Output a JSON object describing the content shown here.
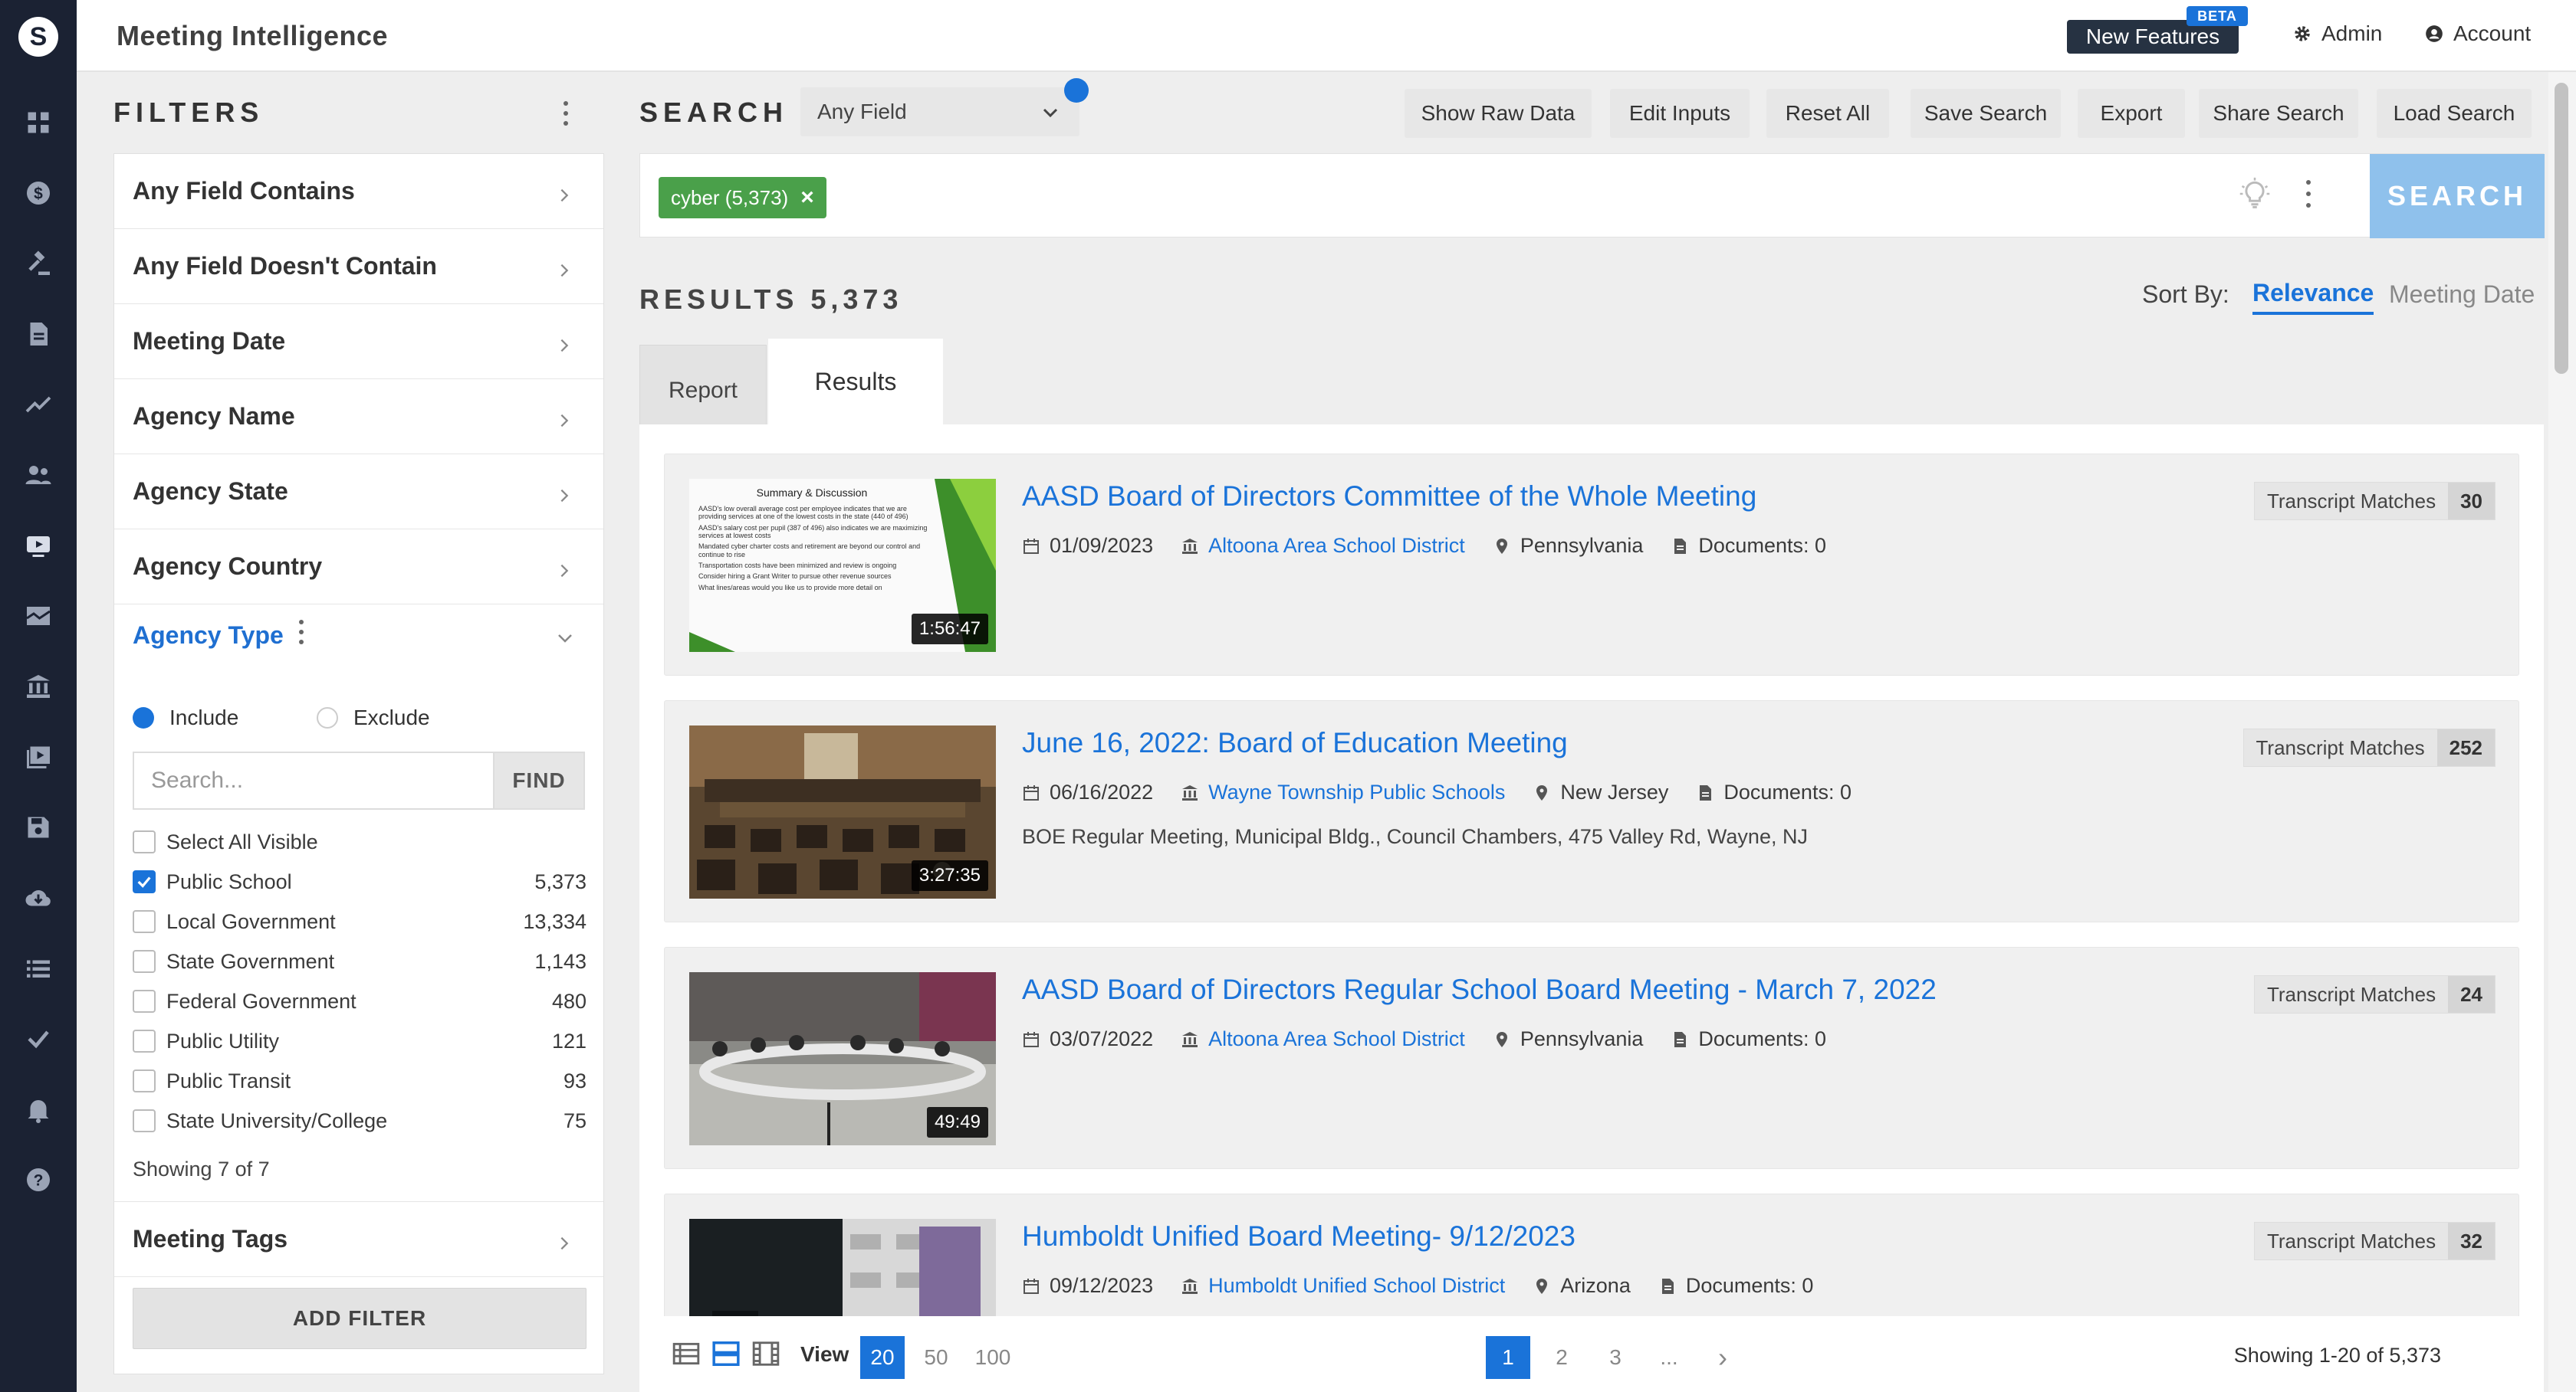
{
  "app": {
    "title": "Meeting Intelligence",
    "logo_glyph": "S"
  },
  "topbar": {
    "new_features": "New Features",
    "beta": "BETA",
    "admin": "Admin",
    "account": "Account"
  },
  "nav_icons": [
    "dashboard-icon",
    "dollar-icon",
    "gavel-icon",
    "document-icon",
    "trend-icon",
    "people-icon",
    "video-icon",
    "map-icon",
    "bank-icon",
    "media-icon",
    "save-icon",
    "cloud-download-icon",
    "list-icon",
    "check-icon",
    "bell-icon",
    "help-icon"
  ],
  "filters": {
    "title": "FILTERS",
    "rows": [
      "Any Field Contains",
      "Any Field Doesn't Contain",
      "Meeting Date",
      "Agency Name",
      "Agency State",
      "Agency Country"
    ],
    "agency_type": {
      "title": "Agency Type",
      "include": "Include",
      "exclude": "Exclude",
      "search_placeholder": "Search...",
      "find": "FIND",
      "select_all": "Select All Visible",
      "options": [
        {
          "label": "Public School",
          "count": "5,373",
          "checked": true
        },
        {
          "label": "Local Government",
          "count": "13,334",
          "checked": false
        },
        {
          "label": "State Government",
          "count": "1,143",
          "checked": false
        },
        {
          "label": "Federal Government",
          "count": "480",
          "checked": false
        },
        {
          "label": "Public Utility",
          "count": "121",
          "checked": false
        },
        {
          "label": "Public Transit",
          "count": "93",
          "checked": false
        },
        {
          "label": "State University/College",
          "count": "75",
          "checked": false
        }
      ],
      "showing": "Showing 7 of 7"
    },
    "meeting_tags": "Meeting Tags",
    "add_filter": "ADD FILTER"
  },
  "search": {
    "title": "SEARCH",
    "field_select": "Any Field",
    "buttons": [
      "Show Raw Data",
      "Edit Inputs",
      "Reset All",
      "Save Search",
      "Export",
      "Share Search",
      "Load Search"
    ],
    "chip": "cyber (5,373)",
    "chip_remove": "×",
    "submit": "SEARCH"
  },
  "results": {
    "title": "RESULTS 5,373",
    "sort_label": "Sort By:",
    "sort_relevance": "Relevance",
    "sort_date": "Meeting Date",
    "tab_report": "Report",
    "tab_results": "Results",
    "match_label": "Transcript Matches",
    "items": [
      {
        "title": "AASD Board of Directors Committee of the Whole Meeting",
        "date": "01/09/2023",
        "agency": "Altoona Area School District",
        "state": "Pennsylvania",
        "docs": "Documents: 0",
        "matches": "30",
        "duration": "1:56:47",
        "desc": "",
        "slide_title": "Summary & Discussion",
        "slide_bullets": [
          "AASD's low overall average cost per employee indicates that we are providing services at one of the lowest costs in the state (440 of 496)",
          "AASD's salary cost per pupil (387 of 496) also indicates we are maximizing services at lowest costs",
          "Mandated cyber charter costs and retirement are beyond our control and continue to rise",
          "Transportation costs have been minimized and review is ongoing",
          "Consider hiring a Grant Writer to pursue other revenue sources",
          "What lines/areas would you like us to provide more detail on"
        ]
      },
      {
        "title": "June 16, 2022: Board of Education Meeting",
        "date": "06/16/2022",
        "agency": "Wayne Township Public Schools",
        "state": "New Jersey",
        "docs": "Documents: 0",
        "matches": "252",
        "duration": "3:27:35",
        "desc": "BOE Regular Meeting, Municipal Bldg., Council Chambers, 475 Valley Rd, Wayne, NJ"
      },
      {
        "title": "AASD Board of Directors Regular School Board Meeting - March 7, 2022",
        "date": "03/07/2022",
        "agency": "Altoona Area School District",
        "state": "Pennsylvania",
        "docs": "Documents: 0",
        "matches": "24",
        "duration": "49:49",
        "desc": ""
      },
      {
        "title": "Humboldt Unified Board Meeting- 9/12/2023",
        "date": "09/12/2023",
        "agency": "Humboldt Unified School District",
        "state": "Arizona",
        "docs": "Documents: 0",
        "matches": "32",
        "duration": "",
        "desc": ""
      }
    ]
  },
  "pager": {
    "view_label": "View",
    "view_options": [
      "20",
      "50",
      "100"
    ],
    "pages": [
      "1",
      "2",
      "3",
      "..."
    ],
    "next": "›",
    "showing": "Showing 1-20 of 5,373"
  },
  "colors": {
    "accent": "#1a73d9",
    "nav_bg": "#1b2233",
    "chip_green": "#4aa04a",
    "search_button": "#8fc1ec"
  }
}
